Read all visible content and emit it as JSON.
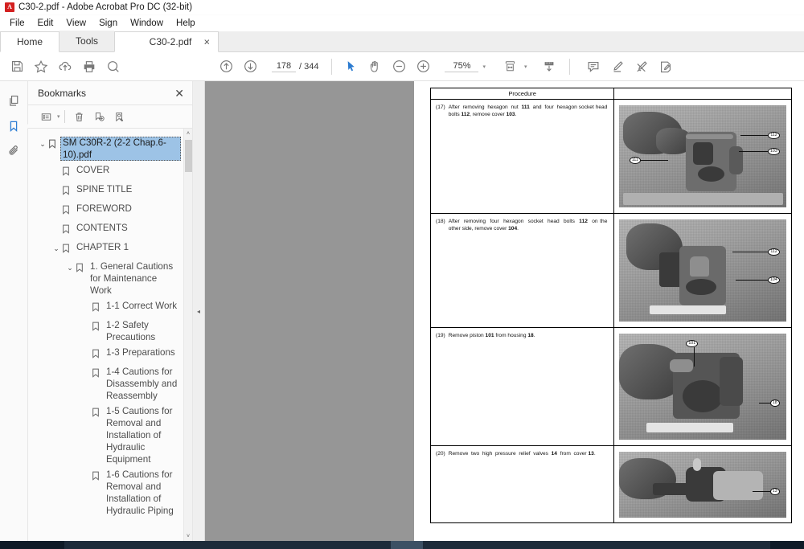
{
  "window": {
    "app_icon": "acrobat-icon",
    "title": "C30-2.pdf - Adobe Acrobat Pro DC (32-bit)"
  },
  "menubar": {
    "items": [
      {
        "label": "File"
      },
      {
        "label": "Edit"
      },
      {
        "label": "View"
      },
      {
        "label": "Sign"
      },
      {
        "label": "Window"
      },
      {
        "label": "Help"
      }
    ]
  },
  "tabs": {
    "home": "Home",
    "tools": "Tools",
    "document": "C30-2.pdf",
    "close_glyph": "×"
  },
  "toolbar": {
    "save_icon": "save-icon",
    "star_icon": "star-icon",
    "upload_icon": "upload-cloud-icon",
    "print_icon": "print-icon",
    "zoom_search_icon": "zoom-search-icon",
    "prev_page_icon": "arrow-up-circle-icon",
    "next_page_icon": "arrow-down-circle-icon",
    "page_number": "178",
    "page_total": "/ 344",
    "select_tool_icon": "cursor-arrow-icon",
    "hand_tool_icon": "hand-icon",
    "zoom_out_icon": "minus-circle-icon",
    "zoom_in_icon": "plus-circle-icon",
    "zoom_value": "75%",
    "zoom_caret": "▾",
    "fit_page_icon": "fit-page-icon",
    "fit_caret": "▾",
    "scroll_mode_icon": "scroll-mode-icon",
    "comment_icon": "comment-icon",
    "highlight_icon": "highlight-pen-icon",
    "draw_icon": "draw-pen-icon",
    "sign_icon": "sign-icon"
  },
  "rail": {
    "items": [
      {
        "name": "page-thumbnails-icon",
        "active": false
      },
      {
        "name": "bookmarks-icon",
        "active": true
      },
      {
        "name": "attachments-icon",
        "active": false
      }
    ]
  },
  "bookmarks_panel": {
    "title": "Bookmarks",
    "close_glyph": "✕",
    "toolbar": {
      "options_icon": "list-options-icon",
      "options_caret": "▾",
      "delete_icon": "trash-icon",
      "new_bookmark_icon": "new-bookmark-icon",
      "edit_bookmark_icon": "edit-bookmark-icon"
    },
    "scroll": {
      "up_glyph": "˄",
      "down_glyph": "˅"
    },
    "tree": [
      {
        "label": "SM C30R-2 (2-2 Chap.6-10).pdf",
        "indent": 0,
        "twisty": "⌄",
        "selected": true
      },
      {
        "label": "COVER",
        "indent": 1,
        "twisty": "",
        "selected": false
      },
      {
        "label": "SPINE TITLE",
        "indent": 1,
        "twisty": "",
        "selected": false
      },
      {
        "label": "FOREWORD",
        "indent": 1,
        "twisty": "",
        "selected": false
      },
      {
        "label": "CONTENTS",
        "indent": 1,
        "twisty": "",
        "selected": false
      },
      {
        "label": "CHAPTER 1",
        "indent": 1,
        "twisty": "⌄",
        "selected": false
      },
      {
        "label": "1. General Cautions for Maintenance Work",
        "indent": 2,
        "twisty": "⌄",
        "selected": false
      },
      {
        "label": "1-1 Correct Work",
        "indent": 3,
        "twisty": "",
        "selected": false
      },
      {
        "label": "1-2 Safety Precautions",
        "indent": 3,
        "twisty": "",
        "selected": false
      },
      {
        "label": "1-3 Preparations",
        "indent": 3,
        "twisty": "",
        "selected": false
      },
      {
        "label": "1-4 Cautions for Disassembly and Reassembly",
        "indent": 3,
        "twisty": "",
        "selected": false
      },
      {
        "label": "1-5 Cautions for Removal and Installation of Hydraulic Equipment",
        "indent": 3,
        "twisty": "",
        "selected": false
      },
      {
        "label": "1-6 Cautions for Removal and Installation of Hydraulic Piping",
        "indent": 3,
        "twisty": "",
        "selected": false
      }
    ]
  },
  "panel_collapse": {
    "glyph": "◂"
  },
  "document": {
    "table_header": "Procedure",
    "steps": [
      {
        "number": "(17)",
        "text_parts": [
          {
            "t": "After removing hexagon nut ",
            "b": false
          },
          {
            "t": "111",
            "b": true
          },
          {
            "t": " and four hexagon socket head bolts ",
            "b": false
          },
          {
            "t": "112",
            "b": true
          },
          {
            "t": ", remove cover ",
            "b": false
          },
          {
            "t": "103",
            "b": true
          },
          {
            "t": ".",
            "b": false
          }
        ],
        "figure_callouts": [
          "111",
          "112",
          "103"
        ]
      },
      {
        "number": "(18)",
        "text_parts": [
          {
            "t": "After removing four hexagon socket head bolts ",
            "b": false
          },
          {
            "t": "112",
            "b": true
          },
          {
            "t": " on the other side, remove cover ",
            "b": false
          },
          {
            "t": "104",
            "b": true
          },
          {
            "t": ".",
            "b": false
          }
        ],
        "figure_callouts": [
          "112",
          "104"
        ]
      },
      {
        "number": "(19)",
        "text_parts": [
          {
            "t": "Remove piston ",
            "b": false
          },
          {
            "t": "101",
            "b": true
          },
          {
            "t": " from housing ",
            "b": false
          },
          {
            "t": "18",
            "b": true
          },
          {
            "t": ".",
            "b": false
          }
        ],
        "figure_callouts": [
          "101",
          "18"
        ]
      },
      {
        "number": "(20)",
        "text_parts": [
          {
            "t": "Remove two high pressure relief valves ",
            "b": false
          },
          {
            "t": "14",
            "b": true
          },
          {
            "t": " from cover ",
            "b": false
          },
          {
            "t": "13",
            "b": true
          },
          {
            "t": ".",
            "b": false
          }
        ],
        "figure_callouts": [
          "13"
        ]
      }
    ]
  }
}
